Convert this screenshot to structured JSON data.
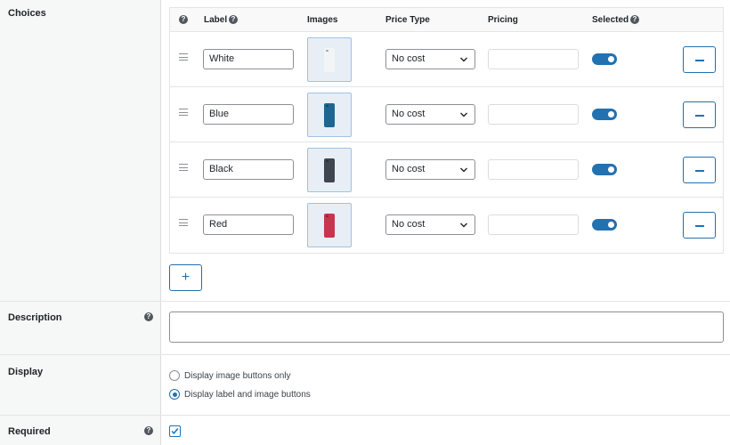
{
  "fields": {
    "choices_label": "Choices",
    "description_label": "Description",
    "display_label": "Display",
    "required_label": "Required"
  },
  "table": {
    "headers": {
      "label": "Label",
      "images": "Images",
      "price_type": "Price Type",
      "pricing": "Pricing",
      "selected": "Selected"
    },
    "rows": [
      {
        "label": "White",
        "phone_color": "#f3f4f6",
        "price_type": "No cost",
        "pricing": "",
        "selected": true
      },
      {
        "label": "Blue",
        "phone_color": "#1f6591",
        "price_type": "No cost",
        "pricing": "",
        "selected": true
      },
      {
        "label": "Black",
        "phone_color": "#3f4650",
        "price_type": "No cost",
        "pricing": "",
        "selected": true
      },
      {
        "label": "Red",
        "phone_color": "#c8354f",
        "price_type": "No cost",
        "pricing": "",
        "selected": true
      }
    ]
  },
  "add_button": "+",
  "description_value": "",
  "display_options": [
    {
      "label": "Display image buttons only",
      "checked": false
    },
    {
      "label": "Display label and image buttons",
      "checked": true
    }
  ],
  "required_checked": true,
  "colors": {
    "accent": "#2271b1",
    "sidebar_bg": "#f6f7f7",
    "border": "#dcdcde"
  }
}
